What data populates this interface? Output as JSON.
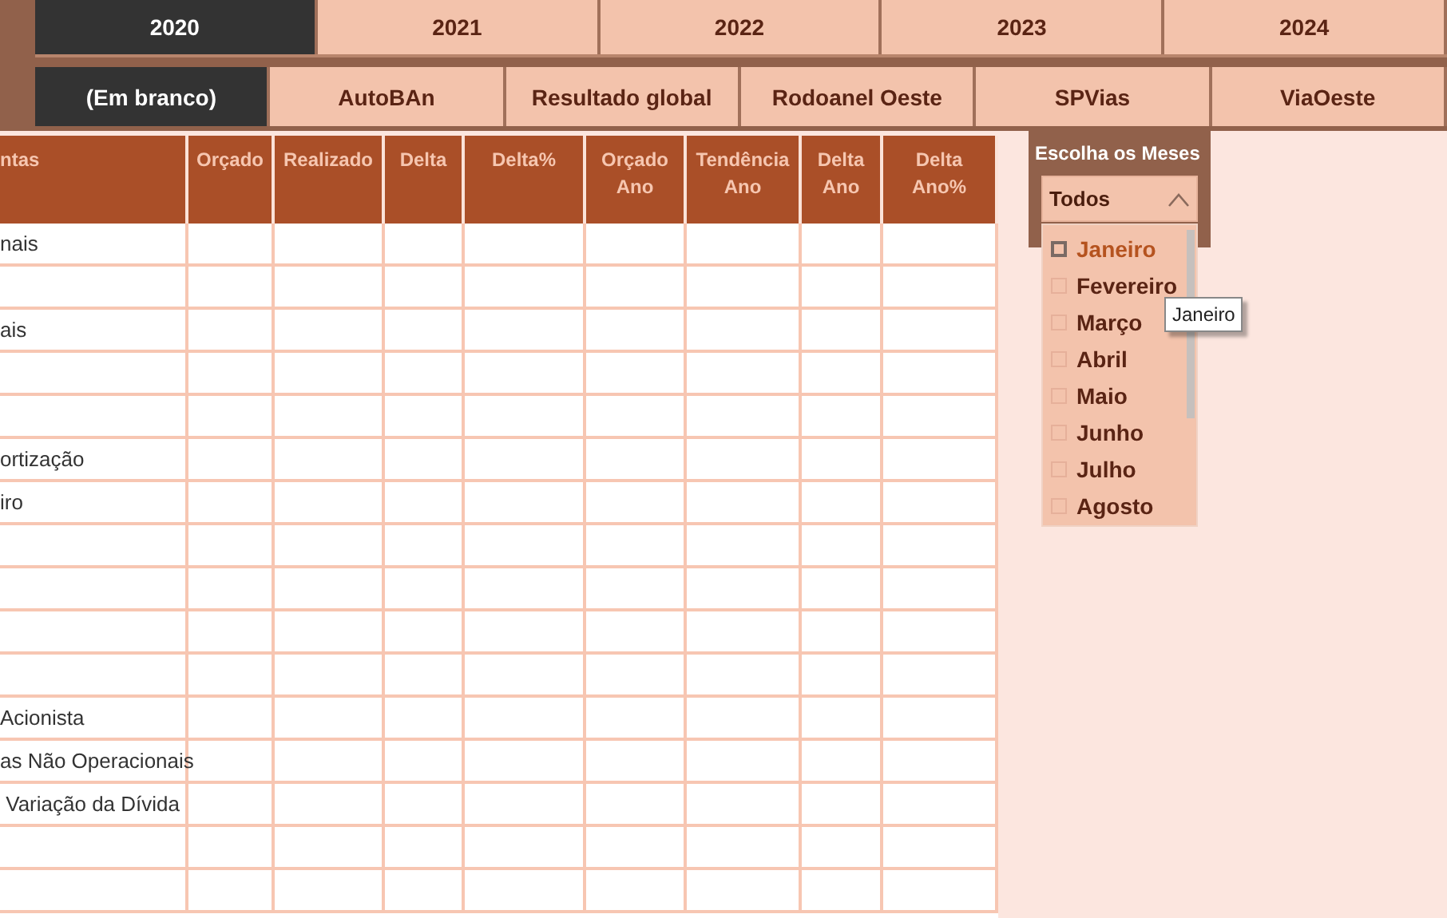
{
  "years": [
    {
      "label": "2020",
      "selected": true
    },
    {
      "label": "2021",
      "selected": false
    },
    {
      "label": "2022",
      "selected": false
    },
    {
      "label": "2023",
      "selected": false
    },
    {
      "label": "2024",
      "selected": false
    }
  ],
  "companies": [
    {
      "label": "(Em branco)",
      "selected": true
    },
    {
      "label": "AutoBAn",
      "selected": false
    },
    {
      "label": "Resultado global",
      "selected": false
    },
    {
      "label": "Rodoanel Oeste",
      "selected": false
    },
    {
      "label": "SPVias",
      "selected": false
    },
    {
      "label": "ViaOeste",
      "selected": false
    }
  ],
  "table": {
    "columns": [
      "ntas",
      "Orçado",
      "Realizado",
      "Delta",
      "Delta%",
      "Orçado Ano",
      "Tendência Ano",
      "Delta Ano",
      "Delta Ano%"
    ],
    "rows": [
      {
        "label": "nais"
      },
      {},
      {
        "label": "ais"
      },
      {},
      {},
      {
        "label": "ortização"
      },
      {
        "label": "iro"
      },
      {},
      {},
      {},
      {},
      {
        "label": "Acionista"
      },
      {
        "label": "as Não Operacionais"
      },
      {
        "label": " Variação da Dívida"
      },
      {},
      {}
    ]
  },
  "month_filter": {
    "title": "Escolha os Meses",
    "value": "Todos",
    "expanded": true,
    "months": [
      {
        "label": "Janeiro",
        "checked": false,
        "hovered": true
      },
      {
        "label": "Fevereiro",
        "checked": false,
        "hovered": false
      },
      {
        "label": "Março",
        "checked": false,
        "hovered": false
      },
      {
        "label": "Abril",
        "checked": false,
        "hovered": false
      },
      {
        "label": "Maio",
        "checked": false,
        "hovered": false
      },
      {
        "label": "Junho",
        "checked": false,
        "hovered": false
      },
      {
        "label": "Julho",
        "checked": false,
        "hovered": false
      },
      {
        "label": "Agosto",
        "checked": false,
        "hovered": false
      }
    ],
    "tooltip": "Janeiro"
  }
}
